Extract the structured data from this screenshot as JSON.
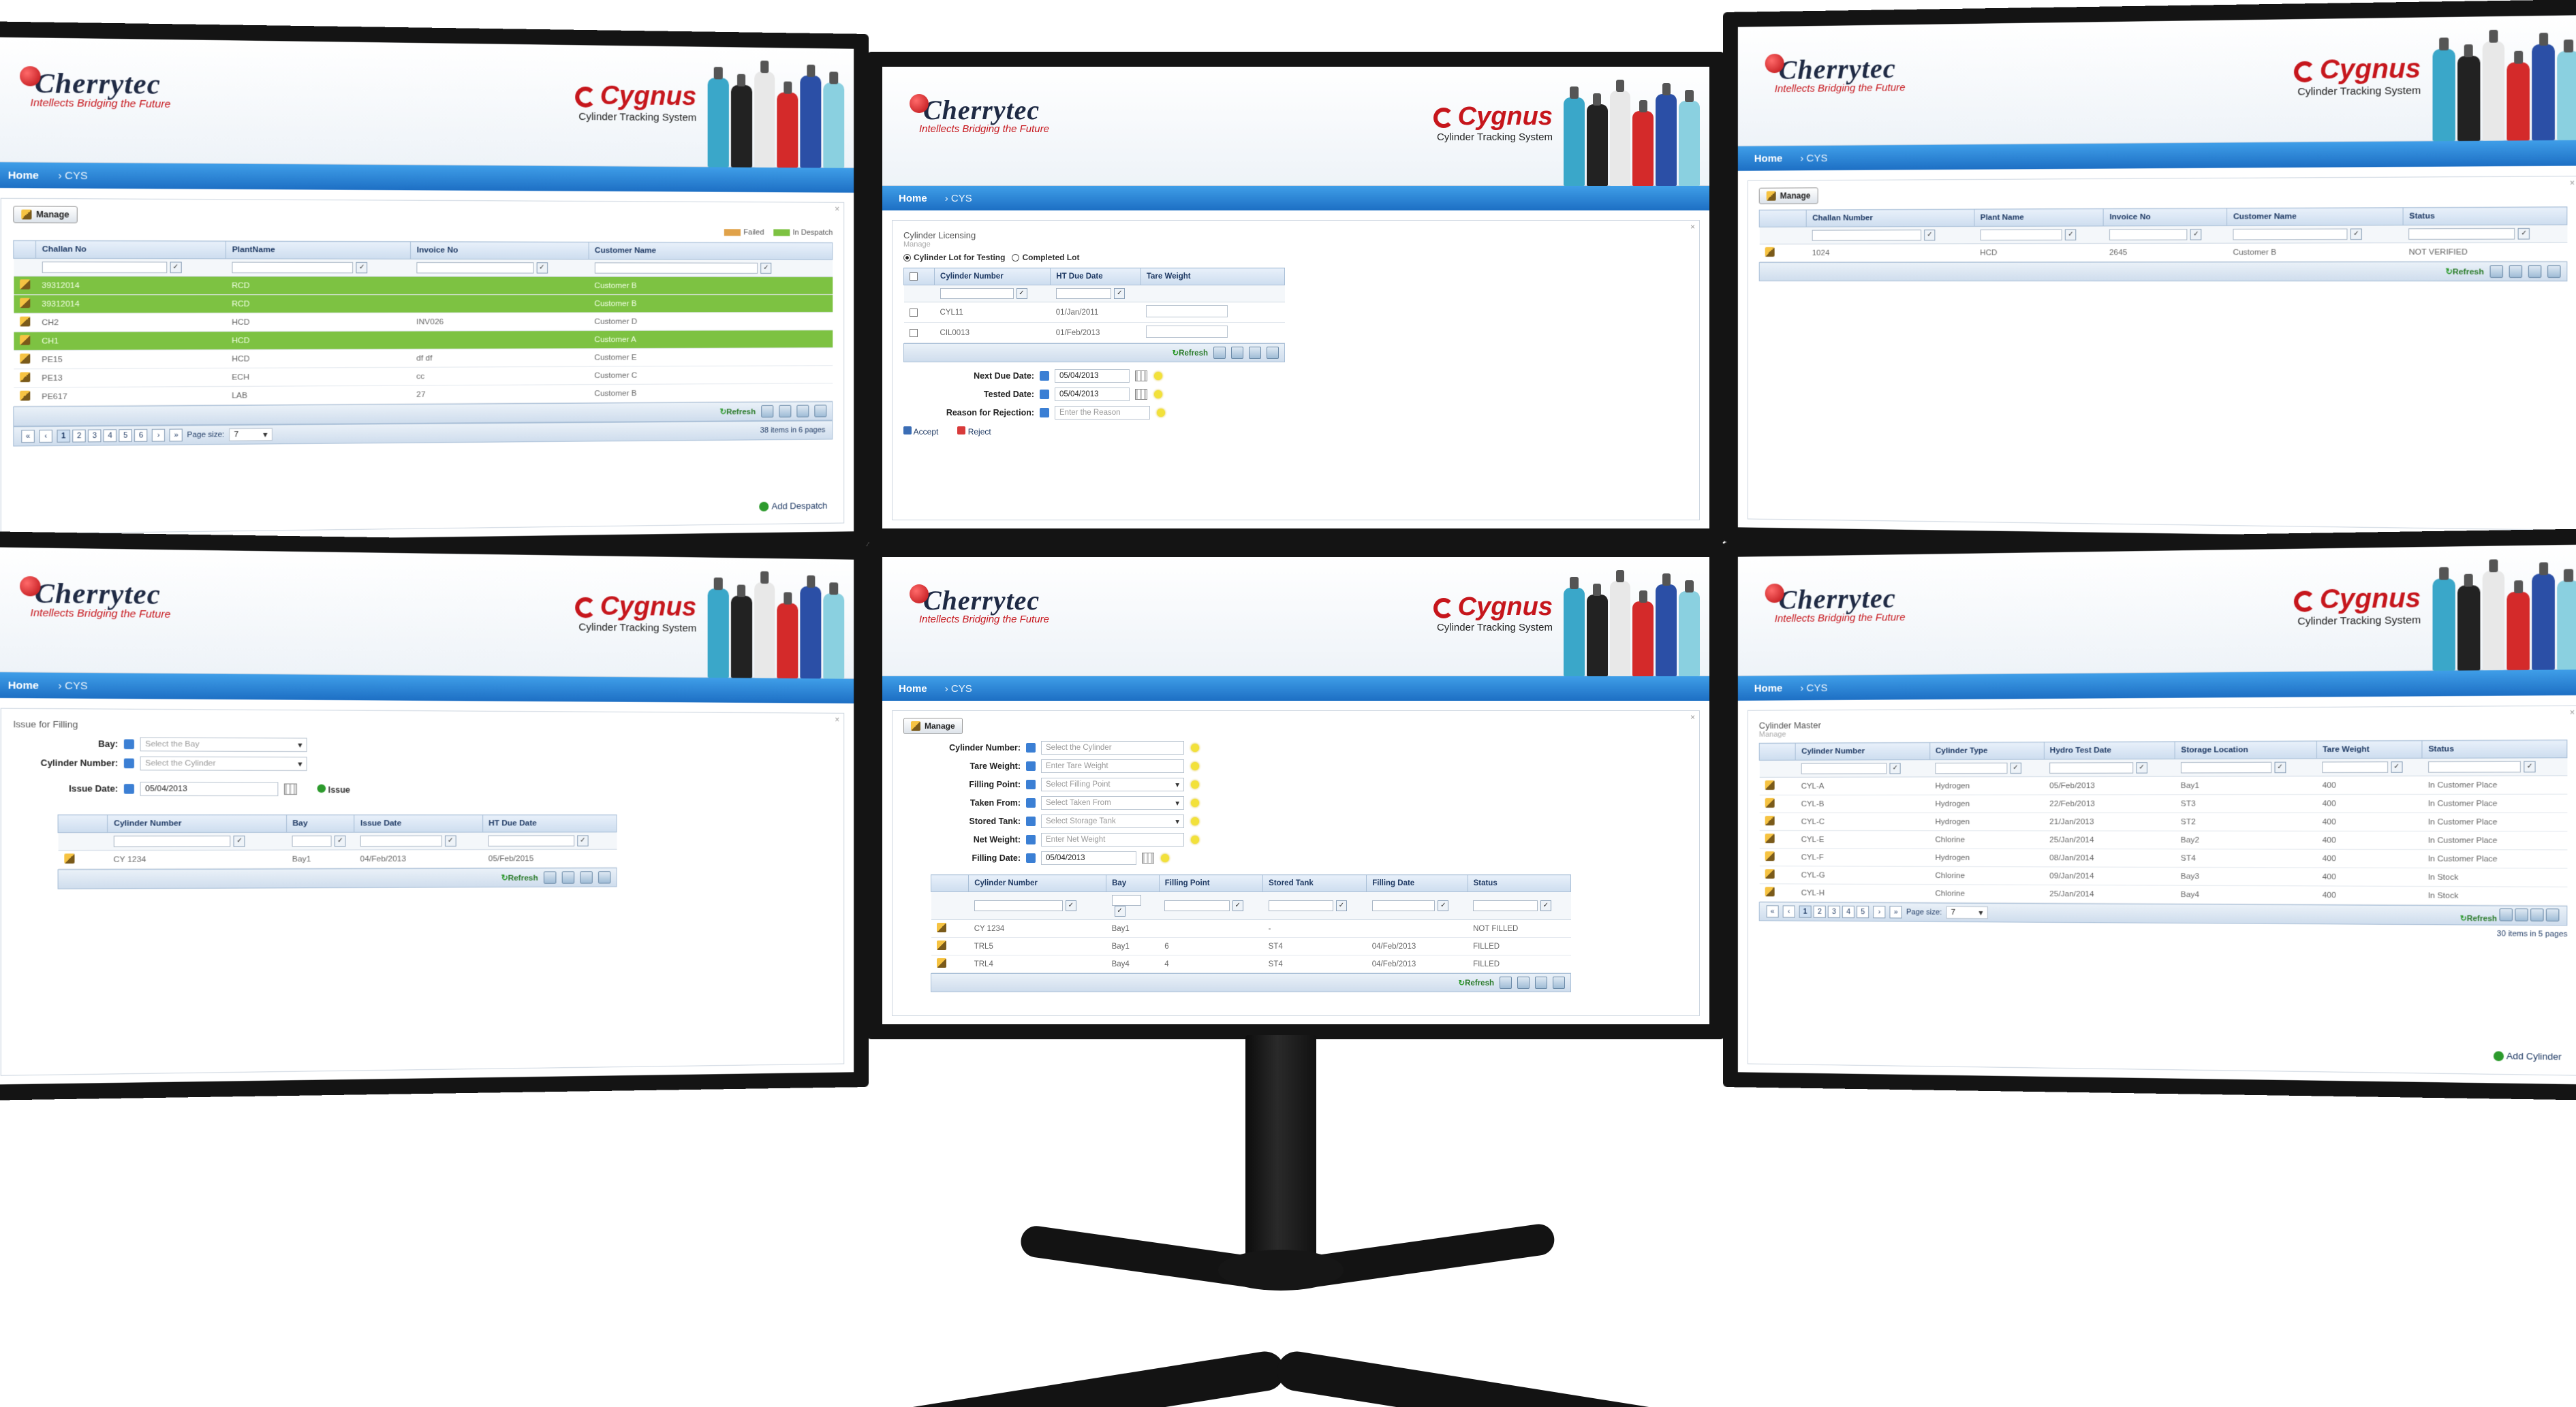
{
  "brand": {
    "company": "Cherrytec",
    "tagline": "Intellects Bridging the Future",
    "product": "Cygnus",
    "product_sub": "Cylinder Tracking System"
  },
  "nav": {
    "home": "Home",
    "module": "CYS"
  },
  "monitors": {
    "tl": {
      "manage_label": "Manage",
      "legend": [
        "Failed",
        "In Despatch"
      ],
      "columns": [
        "Challan No",
        "PlantName",
        "Invoice No",
        "Customer Name"
      ],
      "rows": [
        {
          "challan": "39312014",
          "plant": "RCD",
          "invoice": "",
          "customer": "Customer B",
          "green": true
        },
        {
          "challan": "39312014",
          "plant": "RCD",
          "invoice": "",
          "customer": "Customer B",
          "green": true
        },
        {
          "challan": "CH2",
          "plant": "HCD",
          "invoice": "INV026",
          "customer": "Customer D",
          "green": false
        },
        {
          "challan": "CH1",
          "plant": "HCD",
          "invoice": "",
          "customer": "Customer A",
          "green": true
        },
        {
          "challan": "PE15",
          "plant": "HCD",
          "invoice": "df df",
          "customer": "Customer E",
          "green": false
        },
        {
          "challan": "PE13",
          "plant": "ECH",
          "invoice": "cc",
          "customer": "Customer C",
          "green": false
        },
        {
          "challan": "PE617",
          "plant": "LAB",
          "invoice": "27",
          "customer": "Customer B",
          "green": false
        }
      ],
      "refresh": "Refresh",
      "pages": [
        "1",
        "2",
        "3",
        "4",
        "5",
        "6"
      ],
      "page_size_label": "Page size:",
      "page_size": "7",
      "pager_info": "38 items in 6 pages",
      "add_link": "Add Despatch"
    },
    "tc": {
      "title": "Cylinder Licensing",
      "subtitle": "Manage",
      "radio_testing": "Cylinder Lot for Testing",
      "radio_completed": "Completed Lot",
      "columns": [
        "Cylinder Number",
        "HT Due Date",
        "Tare Weight"
      ],
      "rows": [
        [
          "CYL11",
          "01/Jan/2011",
          ""
        ],
        [
          "CIL0013",
          "01/Feb/2013",
          ""
        ]
      ],
      "refresh": "Refresh",
      "next_due_label": "Next Due Date:",
      "next_due": "05/04/2013",
      "tested_label": "Tested Date:",
      "tested": "05/04/2013",
      "reason_label": "Reason for Rejection:",
      "reason_ph": "Enter the Reason",
      "accept": "Accept",
      "reject": "Reject"
    },
    "tr": {
      "manage_label": "Manage",
      "columns": [
        "Challan Number",
        "Plant Name",
        "Invoice No",
        "Customer Name",
        "Status"
      ],
      "rows": [
        [
          "1024",
          "HCD",
          "2645",
          "Customer B",
          "NOT VERIFIED"
        ]
      ],
      "refresh": "Refresh"
    },
    "bl": {
      "title": "Issue for Filling",
      "bay_label": "Bay:",
      "bay_ph": "Select the Bay",
      "cyl_label": "Cylinder Number:",
      "cyl_ph": "Select the Cylinder",
      "issue_label": "Issue Date:",
      "issue_date": "05/04/2013",
      "issue_btn": "Issue",
      "columns": [
        "Cylinder Number",
        "Bay",
        "Issue Date",
        "HT Due Date"
      ],
      "rows": [
        [
          "CY 1234",
          "Bay1",
          "04/Feb/2013",
          "05/Feb/2015"
        ]
      ],
      "refresh": "Refresh"
    },
    "bc": {
      "manage_label": "Manage",
      "fields": [
        {
          "label": "Cylinder Number:",
          "ph": "Select the Cylinder",
          "kind": "text"
        },
        {
          "label": "Tare Weight:",
          "ph": "Enter Tare Weight",
          "kind": "text"
        },
        {
          "label": "Filling Point:",
          "ph": "Select Filling Point",
          "kind": "select"
        },
        {
          "label": "Taken From:",
          "ph": "Select Taken From",
          "kind": "select"
        },
        {
          "label": "Stored Tank:",
          "ph": "Select Storage Tank",
          "kind": "select"
        },
        {
          "label": "Net Weight:",
          "ph": "Enter Net Weight",
          "kind": "text"
        },
        {
          "label": "Filling Date:",
          "ph": "05/04/2013",
          "kind": "date"
        }
      ],
      "columns": [
        "Cylinder Number",
        "Bay",
        "Filling Point",
        "Stored Tank",
        "Filling Date",
        "Status"
      ],
      "rows": [
        [
          "CY 1234",
          "Bay1",
          "",
          "-",
          "",
          "NOT FILLED"
        ],
        [
          "TRL5",
          "Bay1",
          "6",
          "ST4",
          "04/Feb/2013",
          "FILLED"
        ],
        [
          "TRL4",
          "Bay4",
          "4",
          "ST4",
          "04/Feb/2013",
          "FILLED"
        ]
      ],
      "refresh": "Refresh"
    },
    "br": {
      "title": "Cylinder Master",
      "subtitle": "Manage",
      "columns": [
        "Cylinder Number",
        "Cylinder Type",
        "Hydro Test Date",
        "Storage Location",
        "Tare Weight",
        "Status"
      ],
      "rows": [
        [
          "CYL-A",
          "Hydrogen",
          "05/Feb/2013",
          "Bay1",
          "400",
          "In Customer Place"
        ],
        [
          "CYL-B",
          "Hydrogen",
          "22/Feb/2013",
          "ST3",
          "400",
          "In Customer Place"
        ],
        [
          "CYL-C",
          "Hydrogen",
          "21/Jan/2013",
          "ST2",
          "400",
          "In Customer Place"
        ],
        [
          "CYL-E",
          "Chlorine",
          "25/Jan/2014",
          "Bay2",
          "400",
          "In Customer Place"
        ],
        [
          "CYL-F",
          "Hydrogen",
          "08/Jan/2014",
          "ST4",
          "400",
          "In Customer Place"
        ],
        [
          "CYL-G",
          "Chlorine",
          "09/Jan/2014",
          "Bay3",
          "400",
          "In Stock"
        ],
        [
          "CYL-H",
          "Chlorine",
          "25/Jan/2014",
          "Bay4",
          "400",
          "In Stock"
        ]
      ],
      "refresh": "Refresh",
      "pages": [
        "1",
        "2",
        "3",
        "4",
        "5"
      ],
      "page_size_label": "Page size:",
      "page_size": "7",
      "pager_info": "30 items in 5 pages",
      "add_link": "Add Cylinder"
    }
  },
  "colors": {
    "nav": "#2a86d8",
    "accent": "#c6161c",
    "rowHighlight": "#7dc242"
  }
}
